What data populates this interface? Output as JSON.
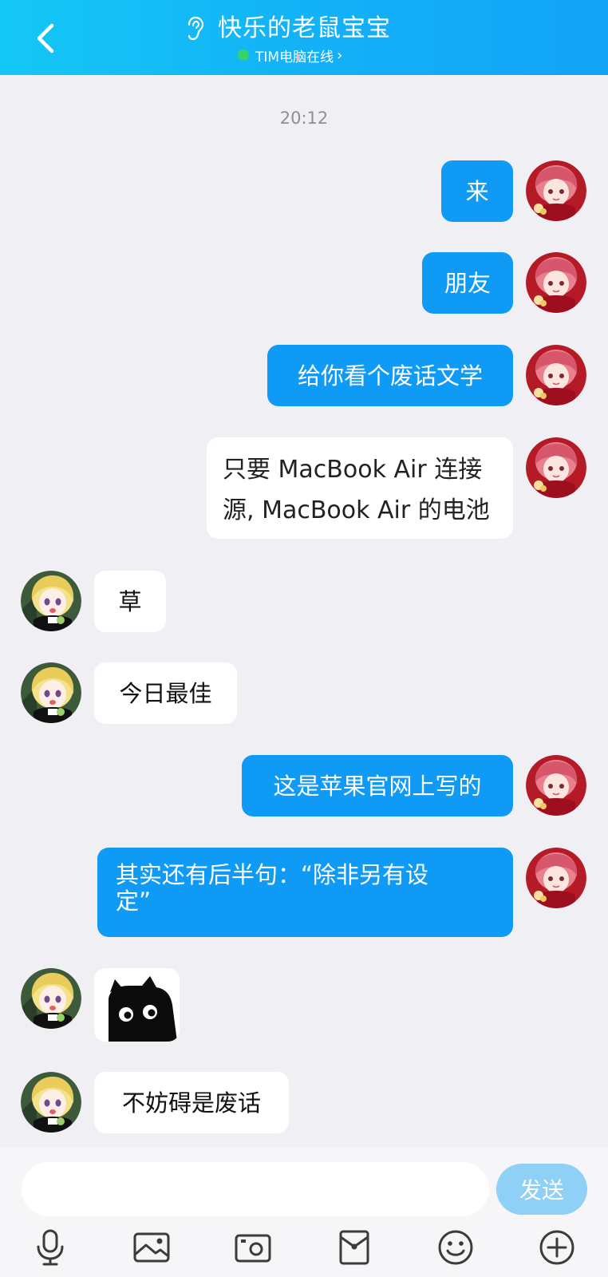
{
  "header": {
    "back_icon": "chevron-left-icon",
    "ear_icon": "ear-icon",
    "title": "快乐的老鼠宝宝",
    "status": "TIM电脑在线",
    "status_chevron": "›",
    "status_color": "#35d46b"
  },
  "chat": {
    "timestamp": "20:12",
    "messages": [
      {
        "side": "out",
        "text": "来"
      },
      {
        "side": "out",
        "text": "朋友"
      },
      {
        "side": "out",
        "text": "给你看个废话文学"
      },
      {
        "side": "out",
        "lines": [
          "只要 MacBook Air 连接",
          "源, MacBook Air 的电池"
        ]
      },
      {
        "side": "in",
        "text": "草"
      },
      {
        "side": "in",
        "text": "今日最佳"
      },
      {
        "side": "out",
        "text": "这是苹果官网上写的"
      },
      {
        "side": "out",
        "lines": [
          "其实还有后半句：“除非另有设",
          "定”"
        ]
      },
      {
        "side": "in",
        "sticker": "black-cat-sticker"
      },
      {
        "side": "in",
        "text": "不妨碍是废话"
      }
    ]
  },
  "input": {
    "placeholder": "",
    "send_label": "发送"
  },
  "toolbar": {
    "icons": [
      "microphone-icon",
      "photo-icon",
      "camera-icon",
      "red-packet-icon",
      "emoji-icon",
      "plus-icon"
    ]
  },
  "colors": {
    "header_gradient_start": "#14c7f5",
    "header_gradient_end": "#12a3f7",
    "outgoing_bubble": "#0f9af5",
    "incoming_bubble": "#ffffff",
    "chat_background": "#efeff4",
    "send_button": "#8fd0f7"
  }
}
